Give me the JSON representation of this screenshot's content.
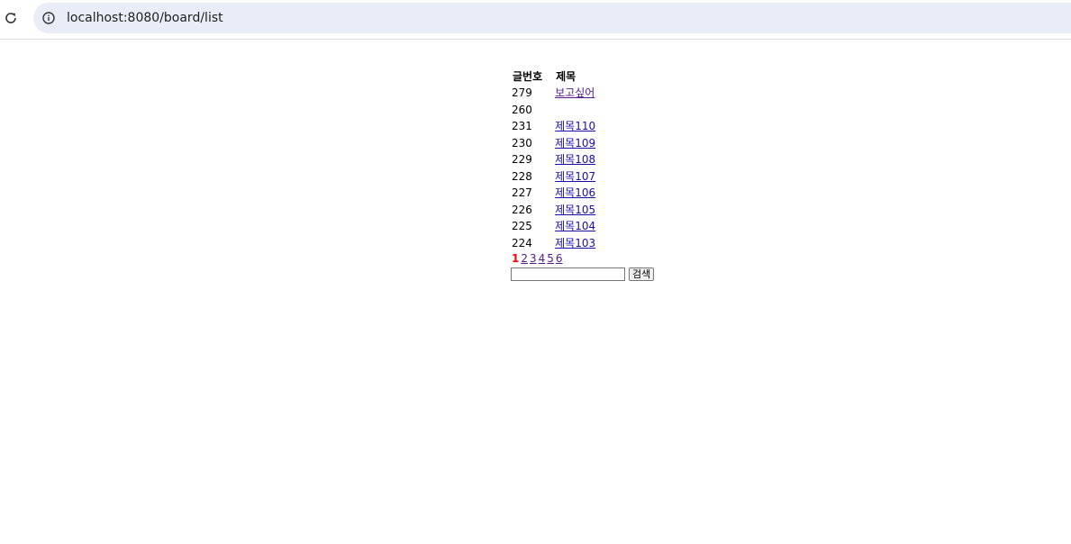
{
  "browser": {
    "url": "localhost:8080/board/list"
  },
  "table": {
    "headers": [
      "글번호",
      "제목"
    ],
    "rows": [
      {
        "num": "279",
        "title": "보고싶어",
        "visited": true
      },
      {
        "num": "260",
        "title": ""
      },
      {
        "num": "231",
        "title": "제목110"
      },
      {
        "num": "230",
        "title": "제목109"
      },
      {
        "num": "229",
        "title": "제목108"
      },
      {
        "num": "228",
        "title": "제목107"
      },
      {
        "num": "227",
        "title": "제목106"
      },
      {
        "num": "226",
        "title": "제목105"
      },
      {
        "num": "225",
        "title": "제목104"
      },
      {
        "num": "224",
        "title": "제목103"
      }
    ]
  },
  "pager": {
    "current": "1",
    "pages": [
      "2",
      "3",
      "4",
      "5",
      "6"
    ]
  },
  "search": {
    "value": "",
    "button_label": "검색"
  },
  "colors": {
    "omnibox_bg": "#e9edf7",
    "link": "#1a0dab",
    "visited_link": "#551a8b",
    "current_page": "#ff0000"
  }
}
